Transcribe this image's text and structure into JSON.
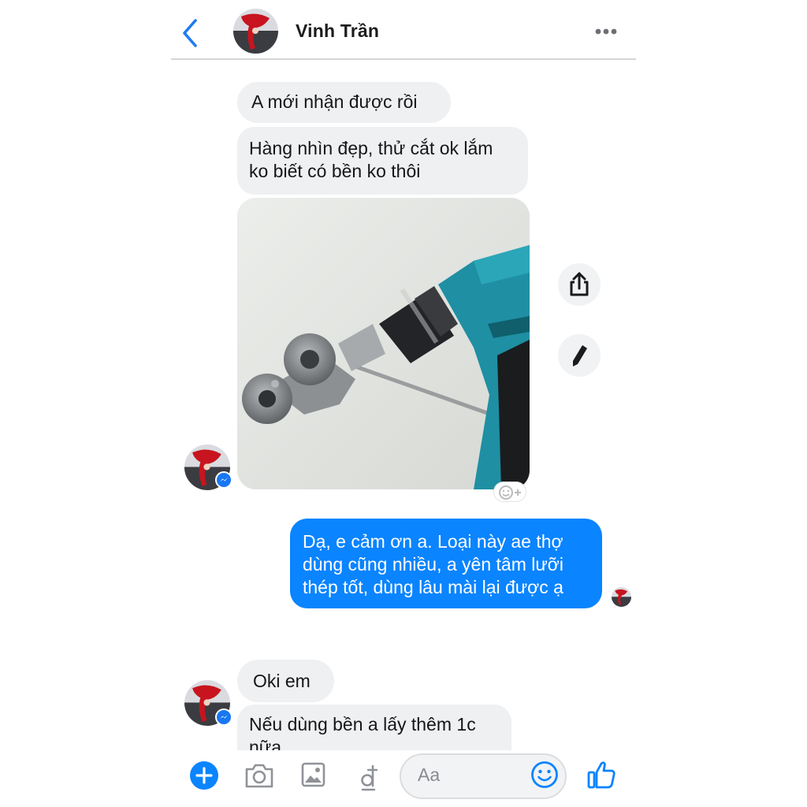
{
  "header": {
    "contact_name": "Vinh Trần"
  },
  "messages": [
    {
      "id": "msg-1",
      "sender": "contact",
      "lines": [
        "A mới nhận được rồi"
      ]
    },
    {
      "id": "msg-2",
      "sender": "contact",
      "lines": [
        "Hàng nhìn đẹp, thử cắt ok lắm",
        "ko biết có bền ko thôi"
      ]
    },
    {
      "id": "msg-3",
      "sender": "me",
      "lines": [
        "Dạ, e cảm ơn a. Loại này ae thợ",
        "dùng cũng nhiều, a yên tâm lưỡi",
        "thép tốt, dùng lâu mài lại được ạ"
      ]
    },
    {
      "id": "msg-4",
      "sender": "contact",
      "lines": [
        "Oki em"
      ]
    },
    {
      "id": "msg-5",
      "sender": "contact",
      "lines": [
        "Nếu dùng bền a lấy thêm 1c",
        "nữa"
      ]
    }
  ],
  "composer": {
    "placeholder": "Aa"
  },
  "colors": {
    "accent": "#0a84ff",
    "incoming_bubble": "#eef0f2",
    "outgoing_text": "#ffffff"
  },
  "icons": {
    "back": "chevron-left-icon",
    "more": "more-dots-icon",
    "share": "share-icon",
    "edit": "pencil-icon",
    "react": "add-reaction-icon",
    "plus": "plus-icon",
    "camera": "camera-icon",
    "gallery": "image-icon",
    "money": "dong-currency-icon",
    "emoji": "smiley-icon",
    "like": "thumbs-up-icon",
    "badge": "messenger-badge-icon"
  }
}
